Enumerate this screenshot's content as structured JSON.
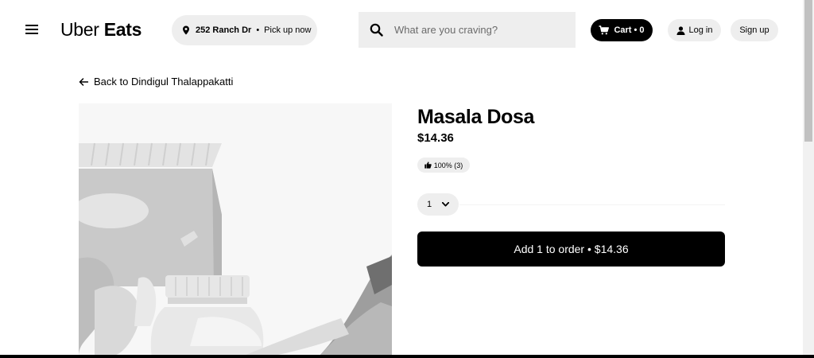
{
  "header": {
    "logo_part1": "Uber",
    "logo_part2": "Eats",
    "location_address": "252 Ranch Dr",
    "location_separator": "•",
    "location_mode": "Pick up now",
    "search_placeholder": "What are you craving?",
    "search_value": "",
    "cart_label": "Cart • 0",
    "login_label": "Log in",
    "signup_label": "Sign up",
    "icons": {
      "menu": "hamburger-menu-icon",
      "location": "location-pin-icon",
      "search": "search-icon",
      "cart": "cart-icon",
      "user": "user-icon"
    }
  },
  "back_link": {
    "label": "Back to Dindigul Thalappakatti",
    "icon": "arrow-left-icon"
  },
  "item": {
    "title": "Masala Dosa",
    "price": "$14.36",
    "rating": "100% (3)",
    "rating_icon": "thumbs-up-icon",
    "quantity_selected": "1",
    "add_button_label": "Add 1 to order • $14.36"
  },
  "colors": {
    "primary": "#000000",
    "pill_bg": "#eeeeee",
    "image_bg": "#f6f6f6"
  }
}
